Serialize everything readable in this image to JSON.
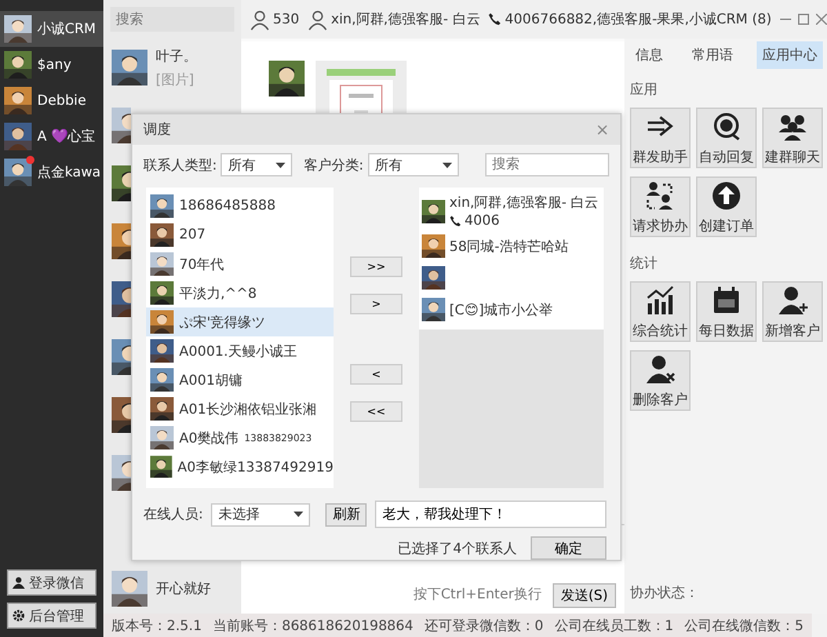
{
  "sidebar": {
    "accounts": [
      {
        "name": "小诚CRM",
        "selected": true,
        "unread": false
      },
      {
        "name": "$any",
        "selected": false,
        "unread": false
      },
      {
        "name": "Debbie",
        "selected": false,
        "unread": false
      },
      {
        "name": "A 💜心宝",
        "selected": false,
        "unread": false
      },
      {
        "name": "点金kawa",
        "selected": false,
        "unread": true
      }
    ],
    "buttons": [
      {
        "label": "登录微信",
        "kind": "person"
      },
      {
        "label": "后台管理",
        "kind": "gear"
      }
    ]
  },
  "chat_list": {
    "search": {
      "placeholder": "搜索"
    },
    "chats": [
      {
        "kind": "chat",
        "name": "叶子。",
        "preview": "[图片]"
      },
      {
        "kind": "picture"
      },
      {
        "kind": "picture"
      },
      {
        "kind": "picture"
      },
      {
        "kind": "picture"
      },
      {
        "kind": "picture"
      },
      {
        "kind": "picture"
      },
      {
        "kind": "picture"
      },
      {
        "kind": "chat",
        "name": "开心就好"
      }
    ]
  },
  "top_bar": {
    "online_count": "530",
    "contact": "xin,阿群,德强客服- 白云",
    "phone": "4006766882,德强客服-果果,小诚CRM (8)"
  },
  "chat": {
    "hint": "按下Ctrl+Enter换行",
    "send": "发送(S)"
  },
  "right_panel": {
    "tabs": [
      {
        "label": "信息",
        "selected": false
      },
      {
        "label": "常用语",
        "selected": false
      },
      {
        "label": "应用中心",
        "selected": true
      }
    ],
    "sections": [
      {
        "title": "应用",
        "tiles": [
          {
            "label": "群发助手",
            "kind": "send"
          },
          {
            "label": "自动回复",
            "kind": "reply"
          },
          {
            "label": "建群聊天",
            "kind": "group"
          },
          {
            "label": "请求协办",
            "kind": "transfer"
          },
          {
            "label": "创建订单",
            "kind": "upload"
          }
        ]
      },
      {
        "title": "统计",
        "tiles": [
          {
            "label": "综合统计",
            "kind": "chart"
          },
          {
            "label": "每日数据",
            "kind": "calendar"
          },
          {
            "label": "新增客户",
            "kind": "person-add"
          },
          {
            "label": "删除客户",
            "kind": "person-remove"
          }
        ]
      }
    ],
    "status_label": "协办状态："
  },
  "status_bar": [
    "版本号：2.5.1",
    "当前账号：868618620198864",
    "还可登录微信数：0",
    "公司在线员工数：1",
    "公司在线微信数：5"
  ],
  "dialog": {
    "title": "调度",
    "close": "×",
    "filters": [
      {
        "label": "联系人类型:",
        "value": "所有"
      },
      {
        "label": "客户分类:",
        "value": "所有"
      }
    ],
    "search": {
      "placeholder": "搜索"
    },
    "contacts": [
      {
        "name": "18686485888",
        "selected": false
      },
      {
        "name": "207",
        "selected": false
      },
      {
        "name": "70年代",
        "selected": false
      },
      {
        "name": "平淡力,^^8",
        "selected": false
      },
      {
        "name": "ぷ宋'竞得缘ツ",
        "selected": true
      },
      {
        "name": "A0001.天鳗小诚王",
        "selected": false
      },
      {
        "name": "A001胡镛",
        "selected": false
      },
      {
        "name": "A01长沙湘依铝业张湘",
        "selected": false
      },
      {
        "name": "A0樊战伟",
        "note": "13883829023",
        "selected": false
      },
      {
        "name": "A0李敏绿13387492919",
        "selected": false
      }
    ],
    "move_buttons": [
      ">>",
      ">",
      "<",
      "<<"
    ],
    "chosen": [
      {
        "kind": "contact",
        "name": "xin,阿群,德强客服- 白云",
        "phone": "4006"
      },
      {
        "kind": "contact",
        "name": "58同城-浩特芒哈站"
      },
      {
        "kind": "avatar"
      },
      {
        "kind": "contact",
        "name": "[C😊]城市小公举"
      }
    ],
    "online_label": "在线人员:",
    "online_value": "未选择",
    "refresh": "刷新",
    "message": "老大，帮我处理下！",
    "selected_count": "已选择了4个联系人",
    "confirm": "确定"
  }
}
